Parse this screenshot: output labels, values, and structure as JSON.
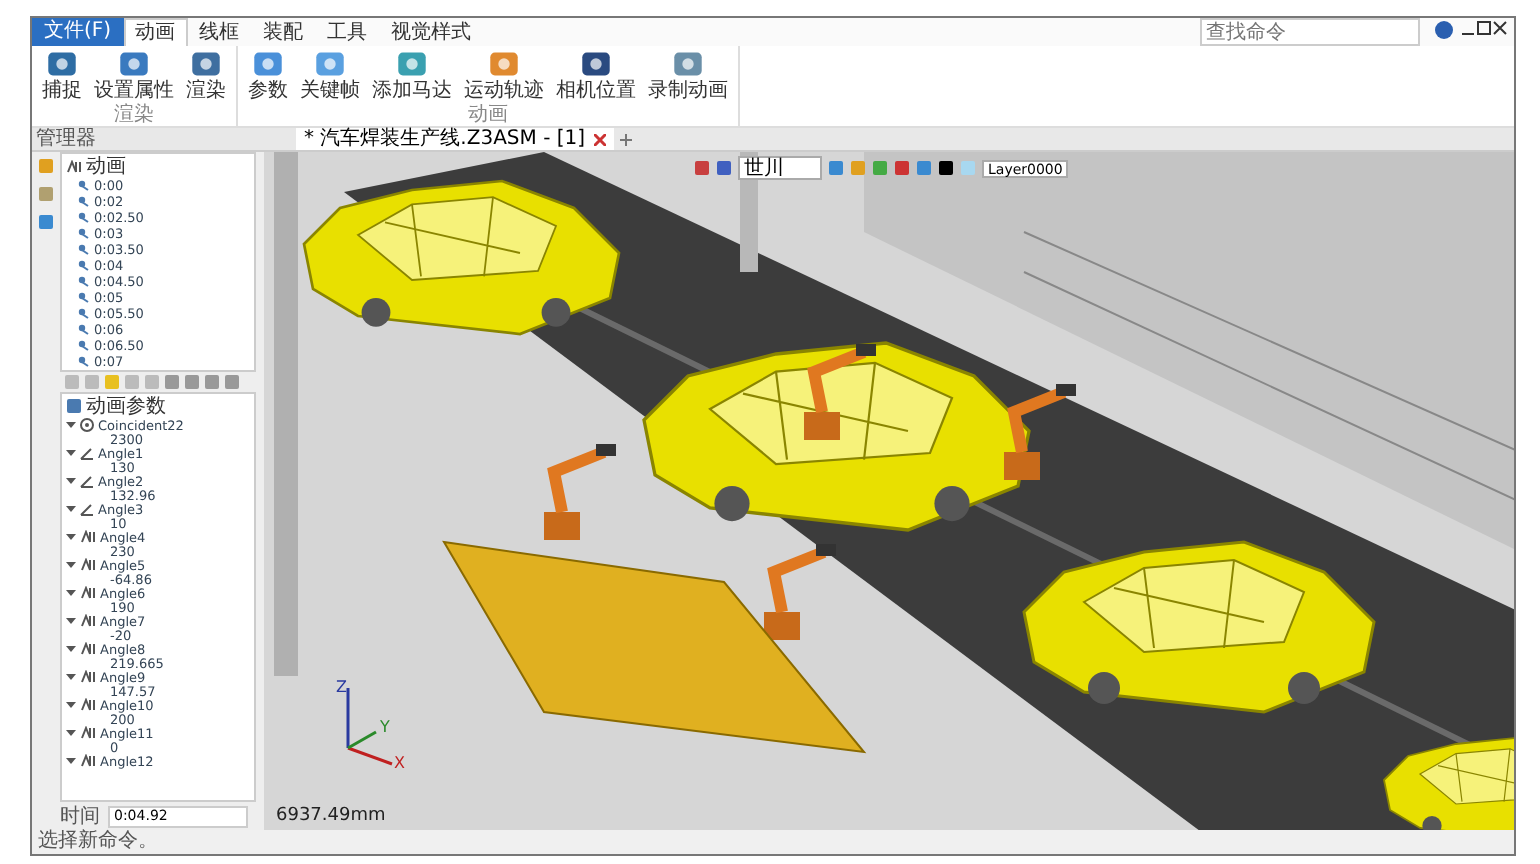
{
  "menu": {
    "file_tab": "文件(F)",
    "tabs": [
      {
        "label": "动画",
        "selected": true
      },
      {
        "label": "线框",
        "selected": false
      },
      {
        "label": "装配",
        "selected": false
      },
      {
        "label": "工具",
        "selected": false
      },
      {
        "label": "视觉样式",
        "selected": false
      }
    ]
  },
  "search": {
    "placeholder": "查找命令"
  },
  "ribbon": {
    "groups": [
      {
        "label": "渲染",
        "buttons": [
          "捕捉",
          "设置属性",
          "渲染"
        ]
      },
      {
        "label": "动画",
        "buttons": [
          "参数",
          "关键帧",
          "添加马达",
          "运动轨迹",
          "相机位置",
          "录制动画"
        ]
      }
    ]
  },
  "manager": {
    "title": "管理器",
    "animation_tree": {
      "label": "动画",
      "children": [
        "0:00",
        "0:02",
        "0:02.50",
        "0:03",
        "0:03.50",
        "0:04",
        "0:04.50",
        "0:05",
        "0:05.50",
        "0:06",
        "0:06.50",
        "0:07"
      ]
    },
    "params_title": "动画参数",
    "params": [
      {
        "kind": "coincident",
        "label": "Coincident22",
        "value": "2300",
        "expanded": true
      },
      {
        "kind": "angle",
        "label": "Angle1",
        "value": "130",
        "expanded": true
      },
      {
        "kind": "angle",
        "label": "Angle2",
        "value": "132.96",
        "expanded": true
      },
      {
        "kind": "angle",
        "label": "Angle3",
        "value": "10",
        "expanded": true
      },
      {
        "kind": "joint",
        "label": "Angle4",
        "value": "230",
        "expanded": true
      },
      {
        "kind": "joint",
        "label": "Angle5",
        "value": "-64.86",
        "expanded": true
      },
      {
        "kind": "joint",
        "label": "Angle6",
        "value": "190",
        "expanded": true
      },
      {
        "kind": "joint",
        "label": "Angle7",
        "value": "-20",
        "expanded": true
      },
      {
        "kind": "joint",
        "label": "Angle8",
        "value": "219.665",
        "expanded": true
      },
      {
        "kind": "joint",
        "label": "Angle9",
        "value": "147.57",
        "expanded": true
      },
      {
        "kind": "joint",
        "label": "Angle10",
        "value": "200",
        "expanded": true
      },
      {
        "kind": "joint",
        "label": "Angle11",
        "value": "0",
        "expanded": true
      },
      {
        "kind": "joint",
        "label": "Angle12",
        "expanded": true
      }
    ],
    "time_label": "时间",
    "time_value": "0:04.92"
  },
  "document_tab": {
    "title": "* 汽车焊装生产线.Z3ASM - [1]"
  },
  "viewport": {
    "style_combo": "世川",
    "layer_combo": "Layer0000",
    "measurement": "6937.49mm",
    "axes": [
      "Z",
      "Y",
      "X"
    ]
  },
  "status_bar": "选择新命令。"
}
